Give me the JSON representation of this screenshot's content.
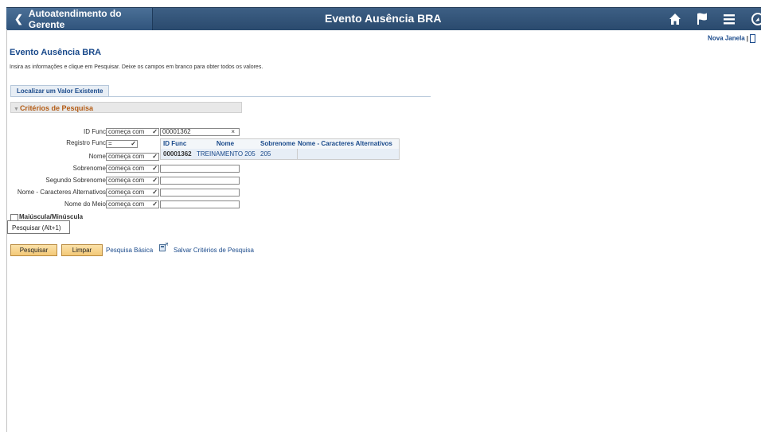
{
  "header": {
    "back_label": "Autoatendimento do Gerente",
    "title": "Evento Ausência BRA",
    "icons": [
      "home-icon",
      "flag-icon",
      "menu-icon",
      "navbar-icon"
    ]
  },
  "nova_janela": "Nova Janela",
  "nova_sep": "|",
  "page": {
    "title": "Evento Ausência BRA",
    "instructions": "Insira as informações e clique em Pesquisar. Deixe os campos em branco para obter todos os valores.",
    "tab": "Localizar um Valor Existente",
    "criteria": "Critérios de Pesquisa"
  },
  "fields": [
    {
      "label": "ID Func",
      "op": "começa com",
      "value": "00001362",
      "clear": "×"
    },
    {
      "label": "Registro Func",
      "op": "=",
      "value": ""
    },
    {
      "label": "Nome",
      "op": "começa com",
      "value": ""
    },
    {
      "label": "Sobrenome",
      "op": "começa com",
      "value": ""
    },
    {
      "label": "Segundo Sobrenome",
      "op": "começa com",
      "value": ""
    },
    {
      "label": "Nome - Caracteres Alternativos",
      "op": "começa com",
      "value": ""
    },
    {
      "label": "Nome do Meio",
      "op": "começa com",
      "value": ""
    }
  ],
  "suggestions": {
    "headers": [
      "ID Func",
      "Nome",
      "Sobrenome",
      "Nome - Caracteres Alternativos"
    ],
    "row": [
      "00001362",
      "TREINAMENTO 205",
      "205",
      ""
    ]
  },
  "case_checkbox": {
    "label": "Maiúscula/Minúscula",
    "checked": false
  },
  "tooltip": "Pesquisar (Alt+1)",
  "actions": {
    "search": "Pesquisar",
    "clear": "Limpar",
    "basic": "Pesquisa Básica",
    "save": "Salvar Critérios de Pesquisa"
  },
  "colors": {
    "header_bg": "#2f5278",
    "link": "#1a4a8b",
    "button": "#f6cf86",
    "criteria_text": "#b35b14"
  }
}
